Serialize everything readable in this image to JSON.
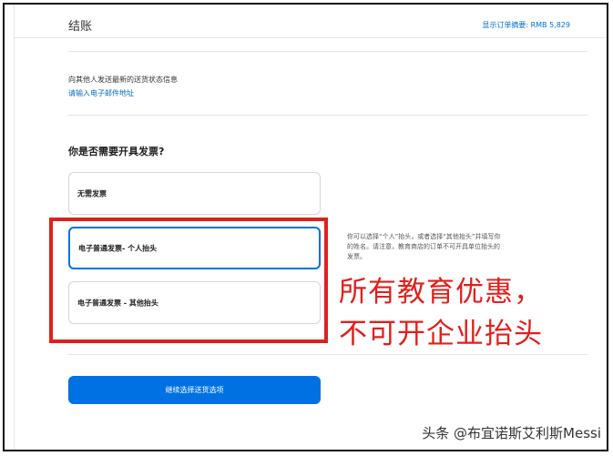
{
  "header": {
    "title": "结账",
    "order_summary": "显示订单摘要: RMB 5,829"
  },
  "notification": {
    "text": "向其他人发送最新的送货状态信息",
    "email_link": "请输入电子邮件地址"
  },
  "invoice": {
    "heading": "你是否需要开具发票?",
    "options": [
      {
        "label": "无需发票",
        "selected": false
      },
      {
        "label": "电子普通发票- 个人抬头",
        "selected": true
      },
      {
        "label": "电子普通发票 - 其他抬头",
        "selected": false
      }
    ],
    "hint": "你可以选择“个人”抬头，或者选择“其他抬头”并填写你的姓名。请注意，教育商店的订单不可开具单位抬头的发票。"
  },
  "annotation": {
    "line1": "所有教育优惠，",
    "line2": "不可开企业抬头",
    "color": "#e0201c"
  },
  "continue_button": {
    "label": "继续选择送货选项",
    "color": "#0071e3"
  },
  "watermark": {
    "text": "头条 @布宜诺斯艾利斯Messi"
  }
}
